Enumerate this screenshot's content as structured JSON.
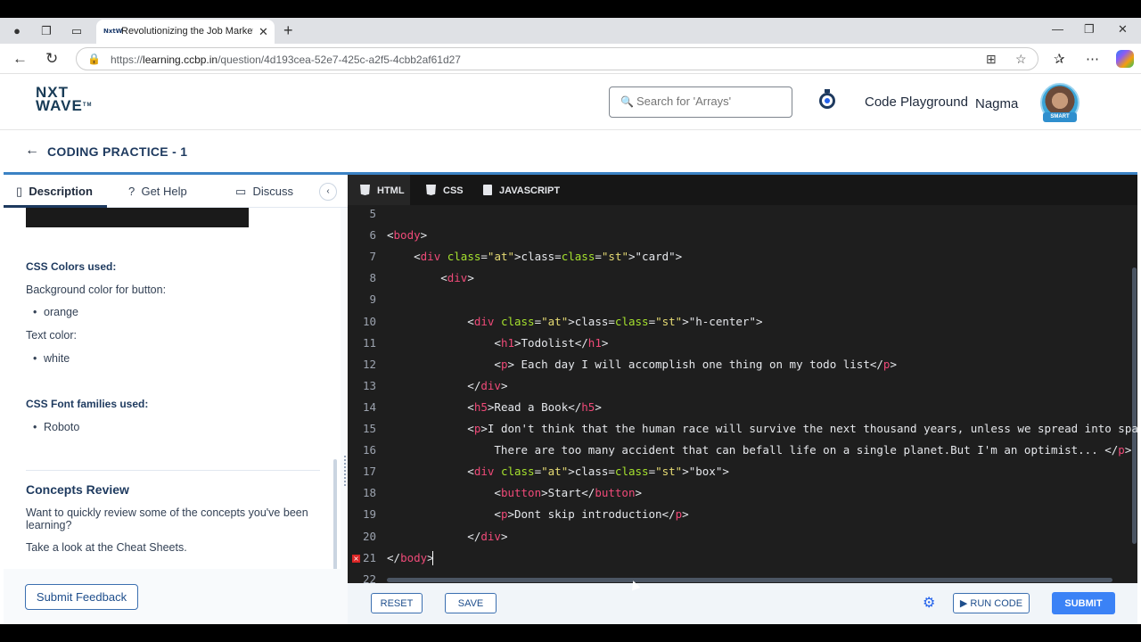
{
  "browser": {
    "tab_title": "Revolutionizing the Job Market | N",
    "favicon_text": "NxtW",
    "url_prefix": "https://",
    "url_host": "learning.ccbp.in",
    "url_path": "/question/4d193cea-52e7-425c-a2f5-4cbb2af61d27"
  },
  "header": {
    "logo_line1": "NXT",
    "logo_line2": "WAVE",
    "logo_tm": "TM",
    "search_placeholder": "Search for 'Arrays'",
    "playground": "Code Playground",
    "user": "Nagma",
    "avatar_badge": "SMART"
  },
  "subheader": {
    "title": "CODING PRACTICE - 1"
  },
  "left_tabs": [
    "Description",
    "Get Help",
    "Discuss"
  ],
  "description": {
    "colors_heading": "CSS Colors used:",
    "bg_label": "Background color for button:",
    "bg_value": "orange",
    "text_label": "Text color:",
    "text_value": "white",
    "fonts_heading": "CSS Font families used:",
    "font_value": "Roboto",
    "concepts_heading": "Concepts Review",
    "concepts_text1": "Want to quickly review some of the concepts you've been",
    "concepts_text1b": "learning?",
    "concepts_text2": "Take a look at the Cheat Sheets."
  },
  "feedback_button": "Submit Feedback",
  "editor_tabs": [
    "HTML",
    "CSS",
    "JAVASCRIPT"
  ],
  "code_lines": [
    {
      "n": "5",
      "text": ""
    },
    {
      "n": "6",
      "text": "<body>"
    },
    {
      "n": "7",
      "text": "    <div class=\"card\">"
    },
    {
      "n": "8",
      "text": "        <div>"
    },
    {
      "n": "9",
      "text": ""
    },
    {
      "n": "10",
      "text": "            <div class=\"h-center\">"
    },
    {
      "n": "11",
      "text": "                <h1>Todolist</h1>"
    },
    {
      "n": "12",
      "text": "                <p> Each day I will accomplish one thing on my todo list</p>"
    },
    {
      "n": "13",
      "text": "            </div>"
    },
    {
      "n": "14",
      "text": "            <h5>Read a Book</h5>"
    },
    {
      "n": "15",
      "text": "            <p>I don't think that the human race will survive the next thousand years, unless we spread into space"
    },
    {
      "n": "16",
      "text": "                There are too many accident that can befall life on a single planet.But I'm an optimist... </p>"
    },
    {
      "n": "17",
      "text": "            <div class=\"box\">"
    },
    {
      "n": "18",
      "text": "                <button>Start</button>"
    },
    {
      "n": "19",
      "text": "                <p>Dont skip introduction</p>"
    },
    {
      "n": "20",
      "text": "            </div>"
    },
    {
      "n": "21",
      "text": "</body>"
    },
    {
      "n": "22",
      "text": ""
    }
  ],
  "error_line": "21",
  "bottom": {
    "reset": "RESET",
    "save": "SAVE",
    "run": "RUN CODE",
    "submit": "SUBMIT"
  }
}
